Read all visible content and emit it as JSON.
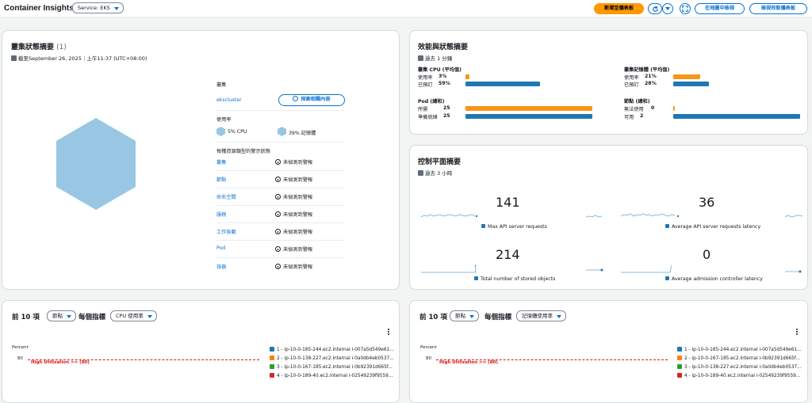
{
  "header": {
    "title": "Container Insights",
    "service_select": "Service: EKS",
    "add_dashboard": "新增至儀表板",
    "explorer": "在地圖中檢視",
    "view_performance": "檢視效能儀表板"
  },
  "cluster_panel": {
    "title": "叢集狀態摘要",
    "count": "(1)",
    "updated": "截至September 26, 2025｜上午11:37 (UTC+08:00)",
    "cluster_label": "叢集",
    "cluster_name": "ekscluster",
    "explore_button": "探索相關內容",
    "usage_label": "使用率",
    "cpu_usage": "5% CPU",
    "mem_usage": "39% 記憶體",
    "alarms_label": "每種資源類型的警示狀態",
    "resources": [
      {
        "name": "叢集",
        "status": "未偵測到警報"
      },
      {
        "name": "節點",
        "status": "未偵測到警報"
      },
      {
        "name": "命名空間",
        "status": "未偵測到警報"
      },
      {
        "name": "服務",
        "status": "未偵測到警報"
      },
      {
        "name": "工作負載",
        "status": "未偵測到警報"
      },
      {
        "name": "Pod",
        "status": "未偵測到警報"
      },
      {
        "name": "容器",
        "status": "未偵測到警報"
      }
    ]
  },
  "performance_panel": {
    "title": "效能與狀態摘要",
    "period": "過去 1 分鐘",
    "cluster_cpu": {
      "title": "叢集 CPU (平均值)",
      "used_label": "使用率",
      "used_value": "3%",
      "used_fraction": 0.03,
      "reserved_label": "已預訂",
      "reserved_value": "59%",
      "reserved_fraction": 0.59
    },
    "cluster_mem": {
      "title": "叢集記憶體 (平均值)",
      "used_label": "使用率",
      "used_value": "21%",
      "used_fraction": 0.21,
      "reserved_label": "已預訂",
      "reserved_value": "28%",
      "reserved_fraction": 0.28
    },
    "pods": {
      "title": "Pod (總和)",
      "desired_label": "所需",
      "desired_value": "25",
      "desired_fraction": 1.0,
      "ready_label": "準備就緒",
      "ready_value": "25",
      "ready_fraction": 1.0
    },
    "nodes": {
      "title": "節點 (總和)",
      "unavailable_label": "無法使用",
      "unavailable_value": "0",
      "unavailable_fraction": 0.01,
      "available_label": "可用",
      "available_value": "2",
      "available_fraction": 1.0
    }
  },
  "control_plane": {
    "title": "控制平面摘要",
    "period": "過去 3 小時",
    "metrics": [
      {
        "value": "141",
        "label": "Max API server requests"
      },
      {
        "value": "36",
        "label": "Average API server requests latency"
      },
      {
        "value": "214",
        "label": "Total number of stored objects"
      },
      {
        "value": "0",
        "label": "Average admission controller latency"
      }
    ]
  },
  "top_left": {
    "prefix": "前 10 項",
    "resource": "節點",
    "per_metric": "每個指標",
    "metric": "CPU 使用率",
    "y_unit": "Percent",
    "y_tick": "80",
    "threshold": "High Utilization >= (80)",
    "legend": [
      {
        "label": "1 - ip-10-0-185-244.ec2.internal i-007a5d549e61...",
        "color": "#1f77b4"
      },
      {
        "label": "2 - ip-10-0-138-227.ec2.internal i-0a0db4eb0537...",
        "color": "#ff7f0e"
      },
      {
        "label": "3 - ip-10-0-167-185.ec2.internal i-0b92391d665f...",
        "color": "#2ca02c"
      },
      {
        "label": "4 - ip-10-0-189-40.ec2.internal i-02549239f9559...",
        "color": "#d62728"
      }
    ]
  },
  "top_right": {
    "prefix": "前 10 項",
    "resource": "節點",
    "per_metric": "每個指標",
    "metric": "記憶體使用率",
    "y_unit": "Percent",
    "y_tick": "80",
    "threshold": "High Utilization >= (80)",
    "legend": [
      {
        "label": "1 - ip-10-0-185-244.ec2.internal i-007a5d549e61...",
        "color": "#1f77b4"
      },
      {
        "label": "2 - ip-10-0-167-185.ec2.internal i-0b92391d665f...",
        "color": "#ff7f0e"
      },
      {
        "label": "3 - ip-10-0-138-227.ec2.internal i-0a0db4eb0537...",
        "color": "#2ca02c"
      },
      {
        "label": "4 - ip-10-0-189-40.ec2.internal i-02549239f9559...",
        "color": "#d62728"
      }
    ]
  }
}
